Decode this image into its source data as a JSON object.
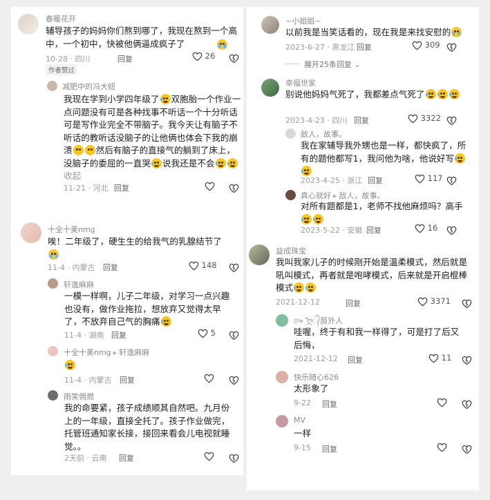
{
  "emoji": {
    "cry": "😭",
    "laugh_cry": "🤣",
    "pleading": "🥺"
  },
  "left": {
    "c1": {
      "name": "春暖花开",
      "text": "辅导孩子的妈妈你们熬到哪了，我现在熬到一个高中，一个初中，快被他俩逼成疯子了",
      "date": "10-28 · 四川",
      "reply": "回复",
      "likes": "26",
      "badge": "作者赞过"
    },
    "c1r1": {
      "name": "减肥中的冯大妞",
      "text_a": "我现在学到小学四年级了",
      "text_b": "双胞胎一个作业一点问题没有可是各种找事不听话一个十分听话可是写作业完全不带脑子。我今天让有脑子不听话的教听话没脑子的让他俩也体会下我的崩溃",
      "text_c": "然后有脑子的直接气的躺到了床上，没脑子的委屈的一直哭",
      "text_d": "说我还是不会",
      "collapse": "收起",
      "date": "11-21 · 河北",
      "reply": "回复"
    },
    "c2": {
      "name": "十全十美nmg",
      "text": "唉！二年级了，硬生生的给我气的乳腺结节了",
      "date": "11-4 · 内蒙古",
      "reply": "回复",
      "likes": "148"
    },
    "c2r1": {
      "name": "轩逸麻麻",
      "text": "一模一样啊，儿子二年级，对学习一点兴趣也没有，做作业拖拉，想放弃又觉得太早了，不放弃自己气的胸痛",
      "date": "11-4 · 湖南",
      "reply": "回复",
      "likes": "5"
    },
    "c2r2": {
      "name": "十全十美nmg",
      "to": "轩逸麻麻",
      "date": "11-4 · 内蒙古",
      "reply": "回复"
    },
    "c2r3": {
      "name": "雨笑佣燃",
      "text": "我的命要紧，孩子成绩顺其自然吧。九月份上的一年级，直接全托了。孩子作业做完，托管班通知家长接，接回来看会儿电视就睡觉。。",
      "date": "2天前 · 云南",
      "reply": "回复"
    }
  },
  "right": {
    "c1": {
      "name": "~小姐姐~",
      "text": "以前我是当笑话看的，现在我是来找安慰的",
      "date": "2023-6-27 · 黑龙江",
      "reply": "回复",
      "likes": "309",
      "expand": "展开25条回复"
    },
    "c2": {
      "name": "幸福世家",
      "text": "别说他妈妈气死了，我都差点气死了",
      "date": "2023-4-23 · 四川",
      "reply": "回复",
      "likes": "3322"
    },
    "c2r1": {
      "name": "敌人，故事。",
      "text": "我在家辅导我外甥也是一样，都快疯了，所有的题他都写1，我问他为啥，他说好写",
      "date": "2023-4-25 · 浙江",
      "reply": "回复",
      "likes": "117"
    },
    "c2r2": {
      "name": "真心就好",
      "to": "敌人，故事。",
      "text": "对所有题都是1，老师不找他麻烦吗？高手",
      "date": "2023-5-22 · 安徽",
      "reply": "回复",
      "likes": "16"
    },
    "c3": {
      "name": "益成珠宝",
      "text": "我叫我家儿子的时候刚开始是温柔模式，然后就是吼叫模式，再者就是咆哮模式，后来就是开启棍棒模式",
      "date": "2021-12-12",
      "reply": "回复",
      "likes": "3371"
    },
    "c3r1": {
      "name": "៚ۣۖ ღ᭄ۣ局外人",
      "text": "哇喔，终于有和我一样得了，可是打了后又后悔，",
      "date": "2021-12-12",
      "reply": "回复",
      "likes": "11"
    },
    "c3r2": {
      "name": "快乐随心626",
      "text": "太形象了",
      "date": "9-22",
      "reply": "回复"
    },
    "c3r3": {
      "name": "MV",
      "text": "一样",
      "date": "9-15",
      "reply": "回复"
    }
  }
}
